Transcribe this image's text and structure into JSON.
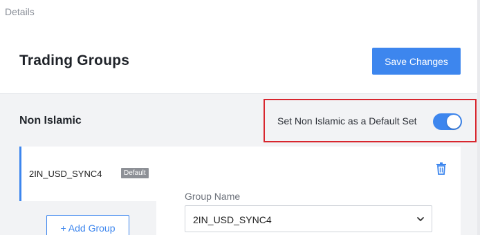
{
  "header": {
    "breadcrumb": "Details",
    "title": "Trading Groups",
    "save_label": "Save Changes"
  },
  "section": {
    "title": "Non Islamic",
    "default_toggle": {
      "label": "Set Non Islamic as a Default Set",
      "enabled": true
    }
  },
  "group_list": {
    "items": [
      {
        "name": "2IN_USD_SYNC4",
        "badge": "Default",
        "selected": true
      }
    ],
    "add_label": "+ Add Group"
  },
  "group_detail": {
    "field_label": "Group Name",
    "selected_value": "2IN_USD_SYNC4",
    "delete_icon": "trash-icon",
    "chevron_icon": "chevron-down-icon"
  },
  "colors": {
    "accent": "#3d86ee",
    "highlight_border": "#d8262e",
    "badge_bg": "#8d9096"
  }
}
